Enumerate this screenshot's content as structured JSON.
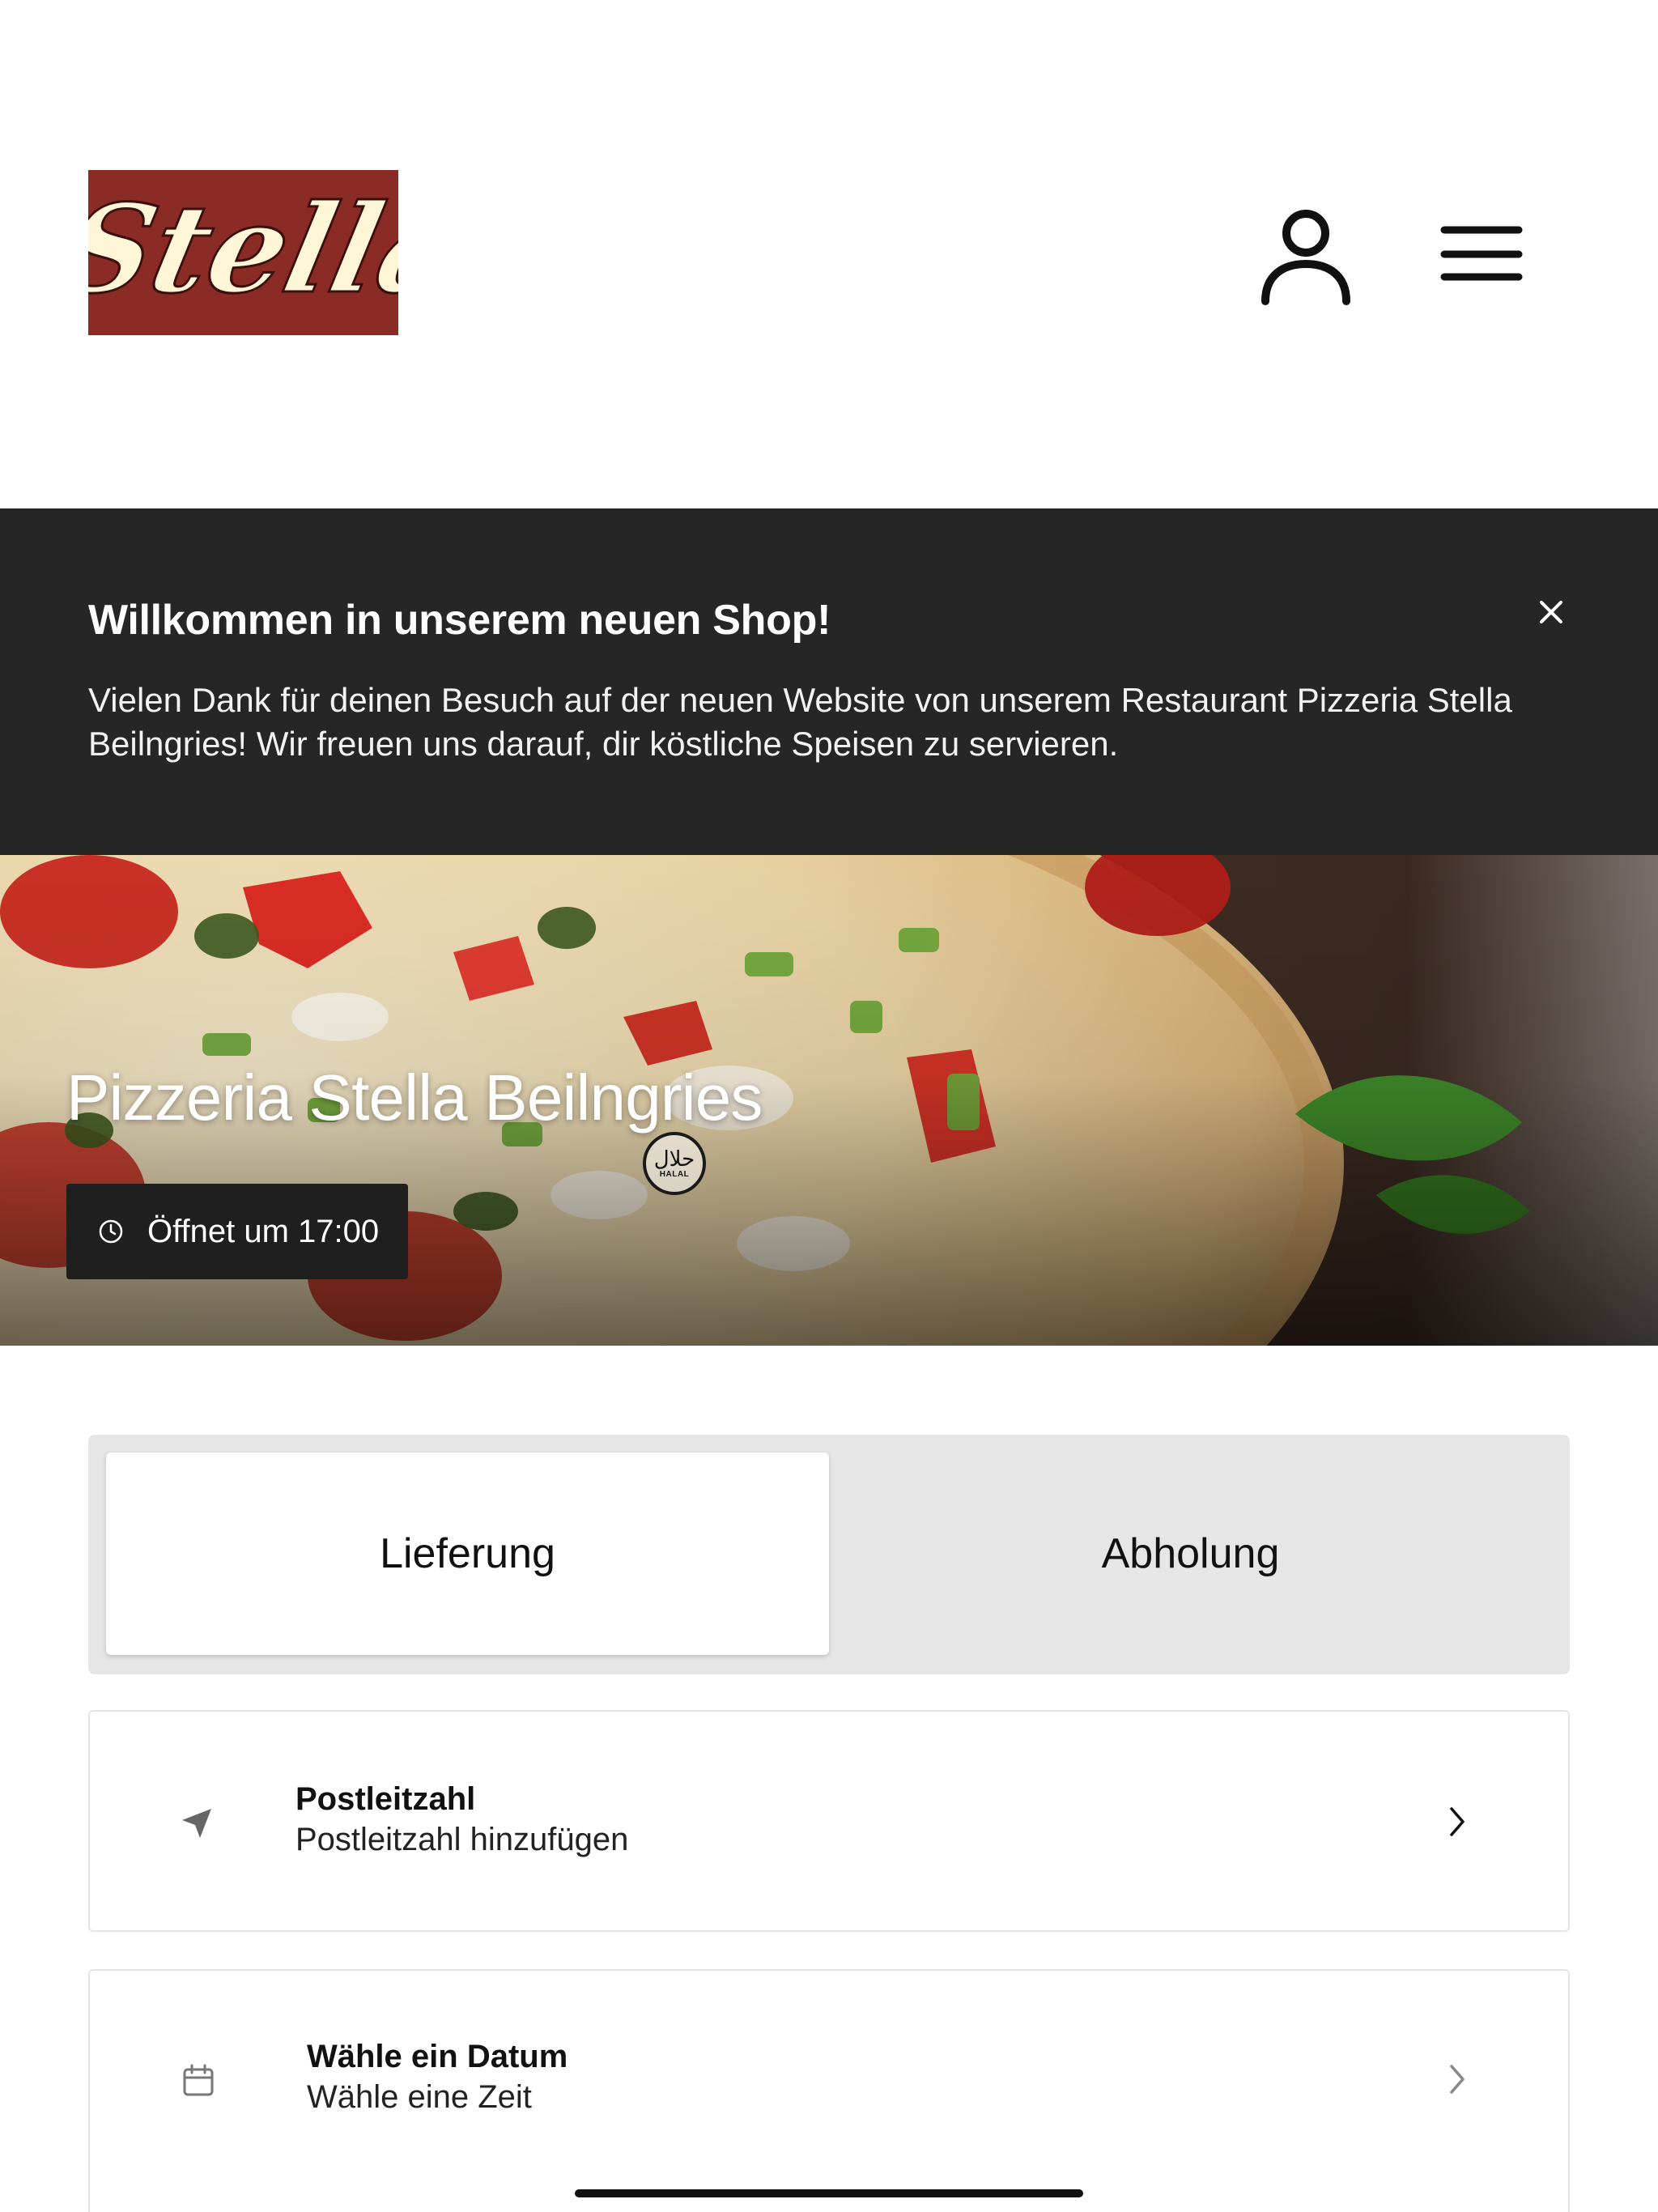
{
  "header": {
    "logo_text": "Stella",
    "account_label": "Konto",
    "menu_label": "Menü"
  },
  "banner": {
    "title": "Willkommen in unserem neuen Shop!",
    "text": "Vielen Dank für deinen Besuch auf der neuen Website von unserem Restaurant Pizzeria Stella Beilngries! Wir freuen uns darauf, dir köstliche Speisen zu servieren."
  },
  "hero": {
    "title": "Pizzeria Stella Beilngries",
    "halal_arabic": "حلال",
    "halal_latin": "HALAL",
    "opening": "Öffnet um 17:00"
  },
  "order_mode": {
    "options": [
      "Lieferung",
      "Abholung"
    ],
    "selected": "Lieferung"
  },
  "postcode": {
    "title": "Postleitzahl",
    "subtitle": "Postleitzahl hinzufügen"
  },
  "schedule": {
    "title": "Wähle ein Datum",
    "subtitle": "Wähle eine Zeit"
  },
  "colors": {
    "brand_red": "#8b2b26",
    "logo_cream": "#fff6d8",
    "banner_bg": "#262626",
    "segment_bg": "#e6e6e6"
  }
}
